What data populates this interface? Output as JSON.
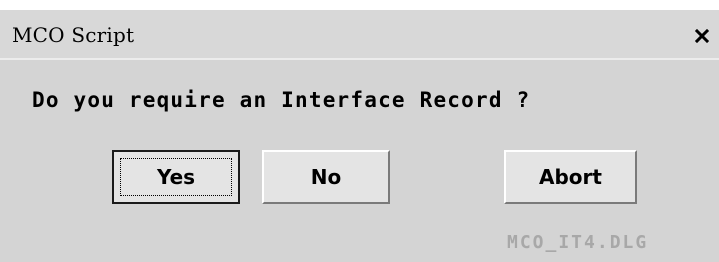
{
  "window": {
    "title": "MCO Script",
    "close_icon": "close-icon"
  },
  "dialog": {
    "message": "Do you require an Interface Record ?",
    "buttons": {
      "yes": "Yes",
      "no": "No",
      "abort": "Abort"
    },
    "footer_id": "MCO_IT4.DLG"
  },
  "colors": {
    "dialog_background": "#d4d4d4",
    "button_face": "#e4e4e4",
    "footer_text": "#a8a8a8"
  }
}
